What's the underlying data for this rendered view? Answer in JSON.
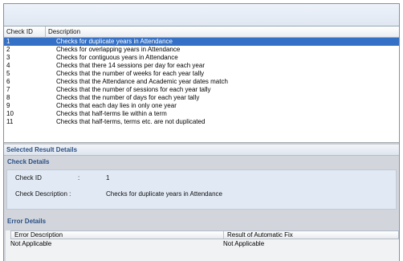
{
  "list": {
    "columns": [
      "Check ID",
      "Description"
    ],
    "rows": [
      {
        "id": "1",
        "desc": "Checks for duplicate years in Attendance",
        "selected": true
      },
      {
        "id": "2",
        "desc": "Checks for overlapping years in Attendance"
      },
      {
        "id": "3",
        "desc": "Checks for contiguous years in Attendance"
      },
      {
        "id": "4",
        "desc": "Checks that there 14 sessions per day for each year"
      },
      {
        "id": "5",
        "desc": "Checks that the number of weeks for each year tally"
      },
      {
        "id": "6",
        "desc": "Checks that the Attendance and Academic year dates match"
      },
      {
        "id": "7",
        "desc": "Checks that the number of sessions for each year tally"
      },
      {
        "id": "8",
        "desc": "Checks that the number of days for each year tally"
      },
      {
        "id": "9",
        "desc": "Checks that each day lies in only one year"
      },
      {
        "id": "10",
        "desc": "Checks that half-terms lie within a term"
      },
      {
        "id": "11",
        "desc": "Checks that half-terms, terms etc. are not duplicated"
      }
    ]
  },
  "selected_panel": {
    "title": "Selected Result Details"
  },
  "check_details": {
    "title": "Check Details",
    "id_label": "Check ID",
    "id_sep": ":",
    "id_value": "1",
    "desc_label": "Check Description :",
    "desc_value": "Checks for duplicate years in Attendance"
  },
  "error_details": {
    "title": "Error Details",
    "columns": [
      "Error Description",
      "Result of Automatic Fix"
    ],
    "rows": [
      {
        "error": "Not Applicable",
        "fix": "Not Applicable"
      }
    ]
  },
  "colors": {
    "selection": "#3470c6",
    "group_title": "#2a4f86",
    "panel_bg": "#d2d6dc"
  }
}
